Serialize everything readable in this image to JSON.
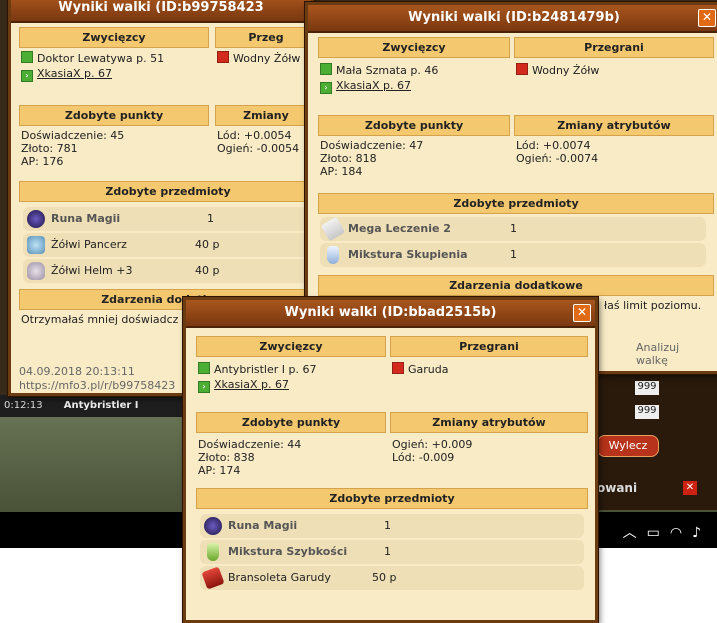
{
  "window1": {
    "title": "Wyniki walki (ID:b99758423",
    "winners_header": "Zwycięzcy",
    "losers_header": "Przeg",
    "winners": [
      "Doktor Lewatywa p. 51",
      "XkasiaX p. 67"
    ],
    "losers": [
      "Wodny Żółw"
    ],
    "points_header": "Zdobyte punkty",
    "changes_header": "Zmiany",
    "points": [
      "Doświadczenie: 45",
      "Złoto: 781",
      "AP: 176"
    ],
    "changes": [
      "Lód: +0.0054",
      "Ogień: -0.0054"
    ],
    "items_header": "Zdobyte przedmioty",
    "items": [
      {
        "icon": "runa-icon",
        "name": "Runa Magii",
        "qty": "1"
      },
      {
        "icon": "pancerz-icon",
        "name": "Żółwi Pancerz",
        "qty": "40 p"
      },
      {
        "icon": "helm-icon",
        "name": "Żółwi Helm +3",
        "qty": "40 p"
      }
    ],
    "events_header": "Zdarzenia dodatkowe",
    "event_text": "Otrzymałaś mniej doświadcz",
    "date": "04.09.2018 20:13:11",
    "url": "https://mfo3.pl/r/b99758423"
  },
  "window2": {
    "title": "Wyniki walki (ID:b2481479b)",
    "winners_header": "Zwycięzcy",
    "losers_header": "Przegrani",
    "winners": [
      "Mała Szmata p. 46",
      "XkasiaX p. 67"
    ],
    "losers": [
      "Wodny Żółw"
    ],
    "points_header": "Zdobyte punkty",
    "changes_header": "Zmiany atrybutów",
    "points": [
      "Doświadczenie: 47",
      "Złoto: 818",
      "AP: 184"
    ],
    "changes": [
      "Lód: +0.0074",
      "Ogień: -0.0074"
    ],
    "items_header": "Zdobyte przedmioty",
    "items": [
      {
        "icon": "scroll-icon",
        "name": "Mega Leczenie 2",
        "qty": "1"
      },
      {
        "icon": "potion-icon",
        "name": "Mikstura Skupienia",
        "qty": "1"
      }
    ],
    "events_header": "Zdarzenia dodatkowe",
    "event_text": "łaś limit poziomu.",
    "analyze": "Analizuj walkę"
  },
  "window3": {
    "title": "Wyniki walki (ID:bbad2515b)",
    "winners_header": "Zwycięzcy",
    "losers_header": "Przegrani",
    "winners": [
      "Antybristler I p. 67",
      "XkasiaX p. 67"
    ],
    "losers": [
      "Garuda"
    ],
    "points_header": "Zdobyte punkty",
    "changes_header": "Zmiany atrybutów",
    "points": [
      "Doświadczenie: 44",
      "Złoto: 838",
      "AP: 174"
    ],
    "changes": [
      "Ogień: +0.009",
      "Lód: -0.009"
    ],
    "items_header": "Zdobyte przedmioty",
    "items": [
      {
        "icon": "runa-icon",
        "name": "Runa Magii",
        "qty": "1"
      },
      {
        "icon": "potion-icon",
        "name": "Mikstura Szybkości",
        "qty": "1"
      },
      {
        "icon": "bransoleta-icon",
        "name": "Bransoleta Garudy",
        "qty": "50 p"
      }
    ]
  },
  "background": {
    "ticker_time": "0:12:13",
    "ticker_name": "Antybristler I",
    "qty_a": "999",
    "qty_b": "999",
    "wylecz": "Wylecz",
    "owani": "owani"
  }
}
